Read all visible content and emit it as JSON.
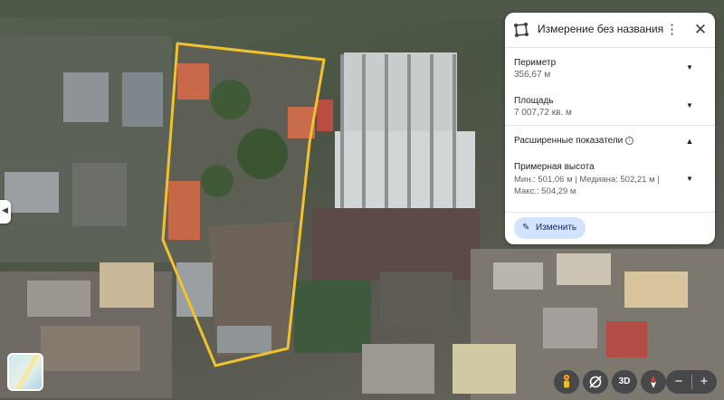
{
  "panel": {
    "title": "Измерение без названия",
    "more_icon": "more-vert-icon",
    "close_icon": "close-icon",
    "perimeter": {
      "label": "Периметр",
      "value": "356,67 м"
    },
    "area": {
      "label": "Площадь",
      "value": "7 007,72 кв. м"
    },
    "advanced": {
      "label": "Расширенные показатели",
      "info_icon": "info-icon"
    },
    "height": {
      "label": "Примерная высота",
      "value": "Мин.: 501,06 м | Медиана: 502,21 м | Макс.: 504,29 м"
    },
    "edit_button": "Изменить",
    "edit_icon": "pencil-icon"
  },
  "controls": {
    "view_3d": "3D",
    "zoom_out": "−",
    "zoom_in": "+",
    "street_view_icon": "pegman-icon",
    "tilt_icon": "tilt-icon",
    "compass_icon": "compass-icon",
    "layers_icon": "map-layers-thumbnail"
  },
  "colors": {
    "polygon_outline": "#f2c12e",
    "button_bg": "#d3e3fd",
    "accent": "#0b57d0"
  }
}
